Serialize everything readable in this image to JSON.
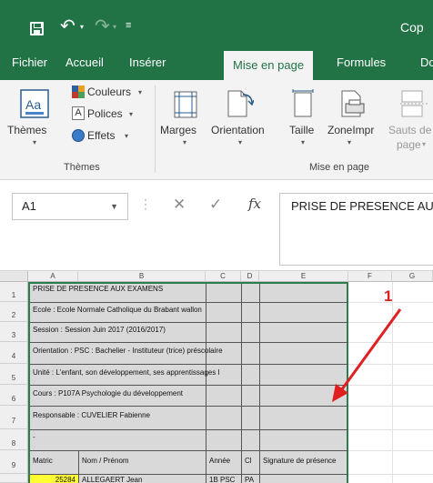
{
  "titlebar": {
    "save_icon": "save-icon",
    "undo_icon": "undo-icon",
    "redo_icon": "redo-icon",
    "document_title": "Cop"
  },
  "tabs": [
    {
      "label": "Fichier"
    },
    {
      "label": "Accueil"
    },
    {
      "label": "Insérer"
    },
    {
      "label": "Mise en page",
      "active": true
    },
    {
      "label": "Formules"
    },
    {
      "label": "Do"
    }
  ],
  "ribbon": {
    "themes": {
      "themes_label": "Thèmes",
      "colors_label": "Couleurs",
      "fonts_label": "Polices",
      "effects_label": "Effets",
      "group_label": "Thèmes"
    },
    "page_setup": {
      "margins_label": "Marges",
      "orientation_label": "Orientation",
      "size_label": "Taille",
      "print_area_label": "ZoneImpr",
      "breaks_label": "Sauts de",
      "breaks_label_2": "page",
      "group_label": "Mise en page"
    }
  },
  "formula_bar": {
    "name_box": "A1",
    "fx_label": "fx",
    "content": "PRISE DE PRESENCE AUX EXAMENS"
  },
  "sheet": {
    "columns": [
      "A",
      "B",
      "C",
      "D",
      "E",
      "F",
      "G"
    ],
    "rows": [
      "1",
      "2",
      "3",
      "4",
      "5",
      "6",
      "7",
      "8",
      "9"
    ],
    "cells": {
      "r1": "PRISE DE PRESENCE AUX EXAMENS",
      "r2": "Ecole : Ecole Normale Catholique du Brabant wallon",
      "r3": "Session : Session Juin 2017 (2016/2017)",
      "r4": "Orientation : PSC : Bachelier - Instituteur (trice) préscolaire",
      "r5": "Unité : L'enfant, son développement, ses apprentissages I",
      "r6": "Cours : P107A Psychologie du développement",
      "r7": "Responsable : CUVELIER Fabienne",
      "r8": "-",
      "h_matric": "Matric",
      "h_nom": "Nom / Prénom",
      "h_annee": "Année",
      "h_cl": "Cl",
      "h_signature": "Signature de présence",
      "d_matric": "25284",
      "d_nom": "ALLEGAERT Jean",
      "d_annee": "1B PSC",
      "d_cl": "PA"
    }
  },
  "annotation": {
    "number": "1",
    "color": "#e02020"
  },
  "colors": {
    "excel_green": "#217346",
    "ribbon_bg": "#f3f3f3",
    "highlight_yellow": "#ffff33"
  }
}
